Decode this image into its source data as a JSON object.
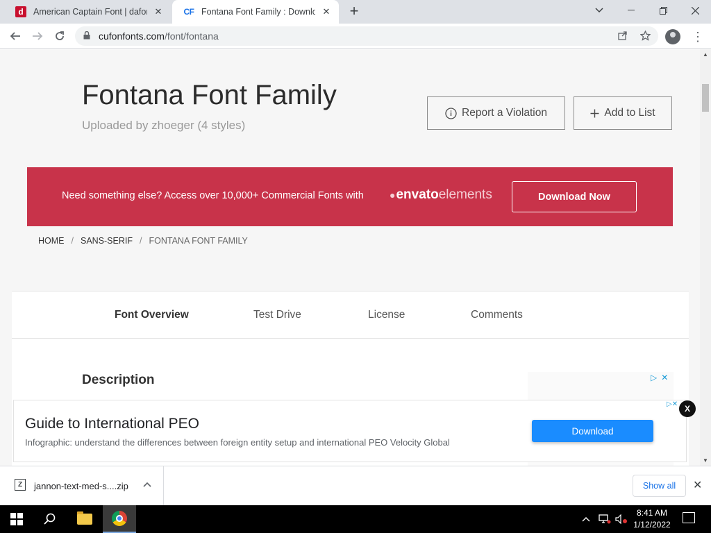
{
  "browser": {
    "tabs": [
      {
        "favicon": "dafont-icon",
        "title": "American Captain Font | dafont.com"
      },
      {
        "favicon": "cf-icon",
        "favicon_text": "CF",
        "title": "Fontana Font Family : Download"
      }
    ],
    "url_host": "cufonfonts.com",
    "url_path": "/font/fontana"
  },
  "page": {
    "title": "Fontana Font Family",
    "uploaded": "Uploaded by zhoeger (4 styles)",
    "report_label": "Report a Violation",
    "add_list_label": "Add to List",
    "banner": {
      "text": "Need something else? Access over 10,000+ Commercial Fonts with",
      "brand_bold": "envato",
      "brand_light": "elements",
      "button": "Download Now",
      "color": "#c8334a"
    },
    "breadcrumb": [
      "HOME",
      "SANS-SERIF",
      "FONTANA FONT FAMILY"
    ],
    "tabs": [
      "Font Overview",
      "Test Drive",
      "License",
      "Comments"
    ],
    "active_tab": "Font Overview",
    "section_heading": "Description"
  },
  "ad": {
    "title": "Guide to International PEO",
    "subtitle": "Infographic: understand the differences between foreign entity setup and international PEO Velocity Global",
    "button": "Download",
    "close_label": "X"
  },
  "downloads": {
    "file_name": "jannon-text-med-s....zip",
    "show_all": "Show all"
  },
  "taskbar": {
    "time": "8:41 AM",
    "date": "1/12/2022"
  }
}
